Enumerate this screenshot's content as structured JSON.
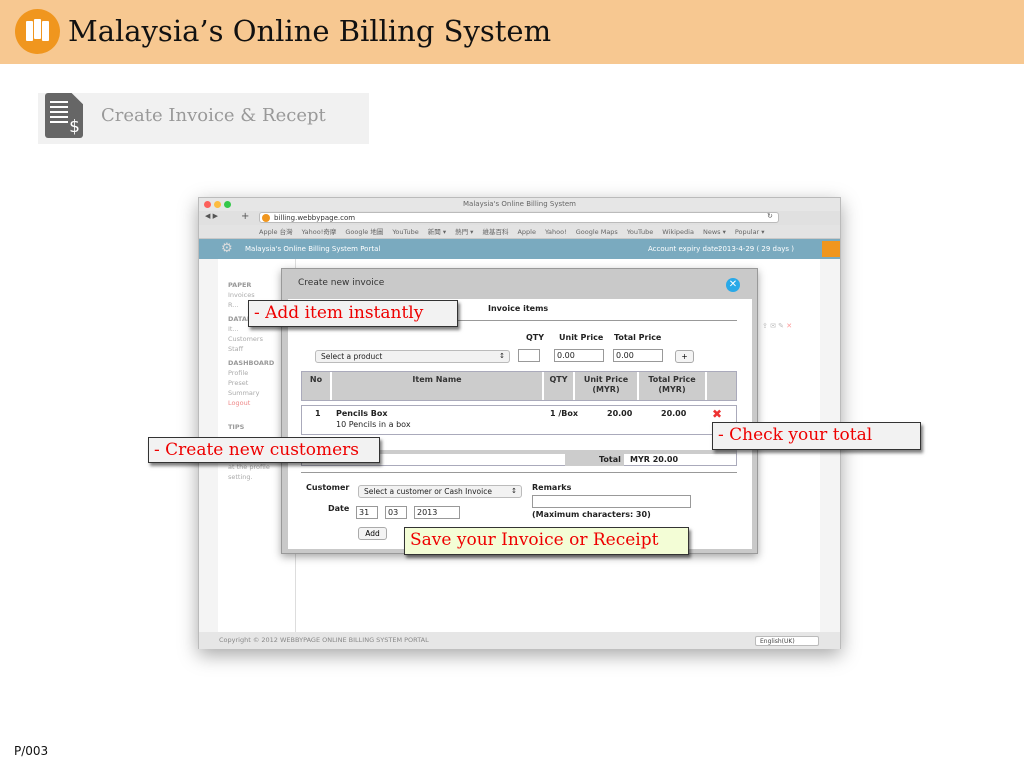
{
  "slide": {
    "title": "Malaysia’s Online Billing System",
    "section_title": "Create Invoice & Recept",
    "page_number": "P/003"
  },
  "browser": {
    "window_title": "Malaysia's Online Billing System",
    "url": "billing.webbypage.com",
    "bookmarks": [
      "Apple 台灣",
      "Yahoo!奇摩",
      "Google 地圖",
      "YouTube",
      "新聞 ▾",
      "熱門 ▾",
      "維基百科",
      "Apple",
      "Yahoo!",
      "Google Maps",
      "YouTube",
      "Wikipedia",
      "News ▾",
      "Popular ▾"
    ]
  },
  "portal": {
    "title": "Malaysia's Online Billing System Portal",
    "expiry_label": "Account expiry date:",
    "expiry_value": "2013-4-29 ( 29 days )",
    "sidebar": {
      "paper_heading": "PAPER",
      "invoices": "Invoices",
      "receipts": "R...",
      "database_heading": "DATAB...",
      "items": "It...",
      "customers": "Customers",
      "staff": "Staff",
      "dashboard_heading": "DASHBOARD",
      "profile": "Profile",
      "preset": "Preset",
      "summary": "Summary",
      "logout": "Logout",
      "tips_heading": "TIPS",
      "tips_text": "at the profile setting."
    },
    "footer": "Copyright © 2012 WEBBYPAGE ONLINE BILLING SYSTEM PORTAL",
    "language": "English(UK)"
  },
  "modal": {
    "title": "Create new invoice",
    "section": "Invoice items",
    "add_row": {
      "qty_label": "QTY",
      "unit_price_label": "Unit Price",
      "total_price_label": "Total Price",
      "product_placeholder": "Select a product",
      "qty": "",
      "unit_price": "0.00",
      "total_price": "0.00",
      "add_button": "+"
    },
    "table": {
      "headers": [
        "No",
        "Item Name",
        "QTY",
        "Unit Price (MYR)",
        "Total Price (MYR)"
      ],
      "rows": [
        {
          "no": "1",
          "name": "Pencils Box",
          "description": "10 Pencils in a box",
          "qty": "1 /Box",
          "unit_price": "20.00",
          "total_price": "20.00"
        }
      ]
    },
    "total_label": "Total",
    "total_value": "MYR 20.00",
    "customer_label": "Customer",
    "customer_placeholder": "Select a customer or Cash Invoice",
    "date_label": "Date",
    "date_day": "31",
    "date_month": "03",
    "date_year": "2013",
    "remarks_label": "Remarks",
    "remarks_value": "",
    "remarks_hint": "(Maximum characters: 30)",
    "add_button": "Add"
  },
  "callouts": {
    "add_item": "- Add item instantly",
    "create_customers": "- Create new customers",
    "check_total": "- Check your total",
    "save_invoice": "Save your Invoice or Receipt"
  },
  "colors": {
    "banner": "#f7c891",
    "logo": "#f0961e",
    "portal_header": "#7aaabf",
    "callout_text": "#e00000",
    "close_button": "#29a9e8"
  }
}
